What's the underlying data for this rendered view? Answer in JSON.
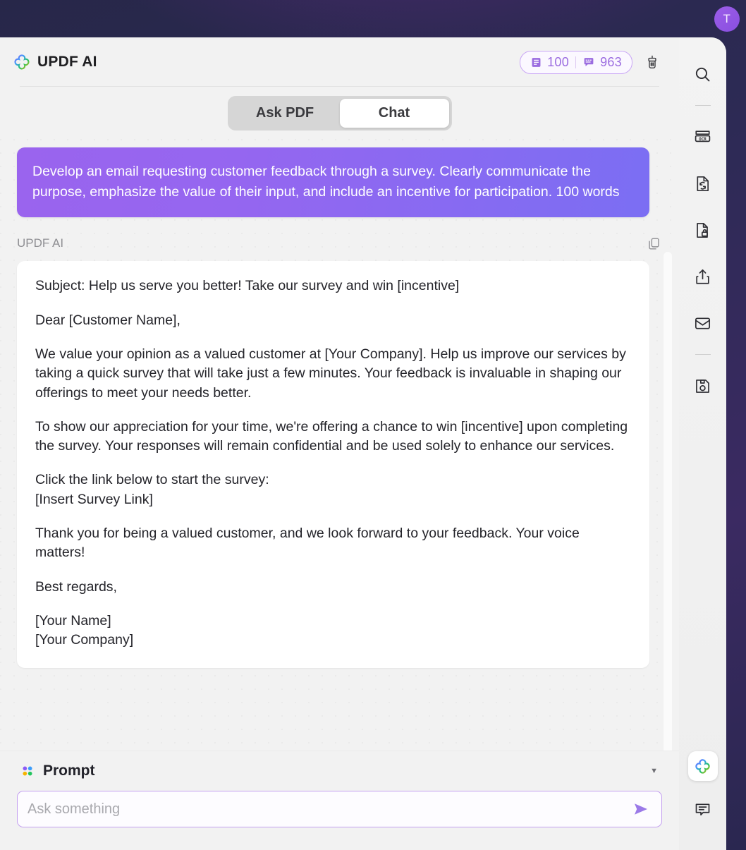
{
  "window": {
    "app_title": "UPDF AI",
    "logo_icon": "updf-clover-logo-icon"
  },
  "desktop": {
    "avatar_initial": "T"
  },
  "header": {
    "credits": {
      "document_icon": "document-credit-icon",
      "document_value": "100",
      "chat_icon": "chat-credit-icon",
      "chat_value": "963"
    },
    "clear_chat_icon": "brush-icon"
  },
  "tabs": [
    {
      "label": "Ask PDF",
      "active": false,
      "name": "tab-ask-pdf"
    },
    {
      "label": "Chat",
      "active": true,
      "name": "tab-chat"
    }
  ],
  "conversation": {
    "user_message": "Develop an email requesting customer feedback through a survey. Clearly communicate the purpose, emphasize the value of their input, and include an incentive for participation. 100 words",
    "assistant_label": "UPDF AI",
    "copy_icon": "copy-icon",
    "assistant_paragraphs": [
      "Subject: Help us serve you better! Take our survey and win [incentive]",
      "Dear [Customer Name],",
      "We value your opinion as a valued customer at [Your Company]. Help us improve our services by taking a quick survey that will take just a few minutes. Your feedback is invaluable in shaping our offerings to meet your needs better.",
      "To show our appreciation for your time, we're offering a chance to win [incentive] upon completing the survey. Your responses will remain confidential and be used solely to enhance our services.",
      "Click the link below to start the survey:\n[Insert Survey Link]",
      "Thank you for being a valued customer, and we look forward to your feedback. Your voice matters!",
      "Best regards,",
      "[Your Name]\n[Your Company]"
    ]
  },
  "composer": {
    "prompt_label": "Prompt",
    "prompt_icon": "four-dots-icon",
    "caret_icon": "chevron-down-icon",
    "input_value": "",
    "input_placeholder": "Ask something",
    "send_icon": "send-arrow-icon"
  },
  "toolbar": {
    "items": [
      {
        "name": "tool-search",
        "icon": "search-icon",
        "type": "button"
      },
      {
        "name": "tool-divider-1",
        "icon": "divider",
        "type": "divider"
      },
      {
        "name": "tool-ocr",
        "icon": "ocr-icon",
        "type": "button"
      },
      {
        "name": "tool-convert",
        "icon": "convert-document-icon",
        "type": "button"
      },
      {
        "name": "tool-protect",
        "icon": "lock-document-icon",
        "type": "button"
      },
      {
        "name": "tool-share",
        "icon": "share-icon",
        "type": "button"
      },
      {
        "name": "tool-email",
        "icon": "mail-icon",
        "type": "button"
      },
      {
        "name": "tool-divider-2",
        "icon": "divider",
        "type": "divider"
      },
      {
        "name": "tool-save",
        "icon": "save-disk-icon",
        "type": "button"
      }
    ],
    "bottom_items": [
      {
        "name": "tool-updf-ai",
        "icon": "updf-clover-logo-icon",
        "active": true
      },
      {
        "name": "tool-comment",
        "icon": "comment-bubble-icon",
        "active": false
      }
    ]
  },
  "colors": {
    "accent_purple": "#9b6ce0",
    "bubble_gradient_start": "#9a64ee",
    "bubble_gradient_end": "#7b6ef3",
    "input_border": "#c3a0ef",
    "desktop_bg": "#2d2a55",
    "avatar_bg": "#9b5de8"
  }
}
